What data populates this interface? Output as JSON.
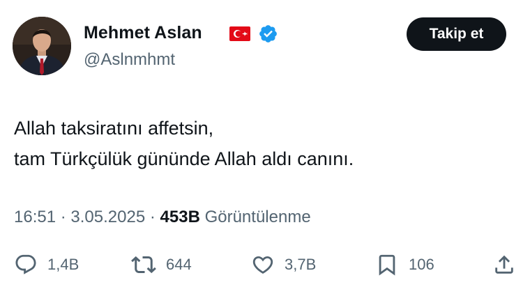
{
  "author": {
    "name": "Mehmet Aslan",
    "handle": "@Aslnmhmt",
    "flag_icon": "turkey-flag-icon",
    "verified_icon": "verified-badge-icon",
    "verified_color": "#1d9bf0"
  },
  "follow_button": {
    "label": "Takip et"
  },
  "tweet": {
    "lines": [
      "Allah taksiratını affetsin,",
      "tam Türkçülük gününde Allah aldı canını."
    ]
  },
  "meta": {
    "time": "16:51",
    "separator": "·",
    "date": "3.05.2025",
    "views_count": "453B",
    "views_label": "Görüntülenme"
  },
  "actions": {
    "reply_count": "1,4B",
    "repost_count": "644",
    "like_count": "3,7B",
    "bookmark_count": "106"
  },
  "colors": {
    "text": "#0f1419",
    "secondary": "#536471",
    "button_bg": "#0f1419",
    "flag_red": "#e30a17"
  }
}
